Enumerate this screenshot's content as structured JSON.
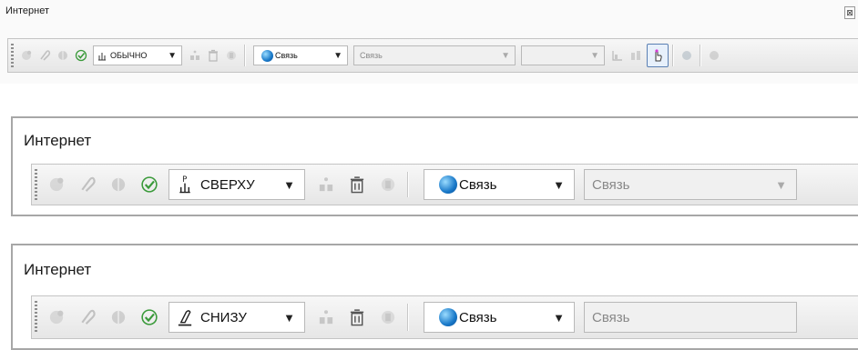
{
  "panels": [
    {
      "title": "Интернет",
      "close_glyph": "⊠",
      "style_combo": {
        "icon": "anchor-icon",
        "value": "ОБЫЧНО"
      },
      "link_combo": {
        "value": "Связь"
      },
      "link_field": {
        "value": "Связь"
      },
      "extra_field": {
        "value": ""
      }
    },
    {
      "title": "Интернет",
      "style_combo": {
        "icon": "anchor-top-icon",
        "value": "СВЕРХУ"
      },
      "link_combo": {
        "value": "Связь"
      },
      "link_field": {
        "value": "Связь"
      }
    },
    {
      "title": "Интернет",
      "style_combo": {
        "icon": "anchor-bottom-icon",
        "value": "СНИЗУ"
      },
      "link_combo": {
        "value": "Связь"
      },
      "link_field": {
        "value": "Связь"
      }
    }
  ],
  "glyphs": {
    "dropdown_arrow": "▼"
  },
  "colors": {
    "check": "#3a9a3a",
    "globe": "#1878c8",
    "hand": "#d43bd4"
  }
}
